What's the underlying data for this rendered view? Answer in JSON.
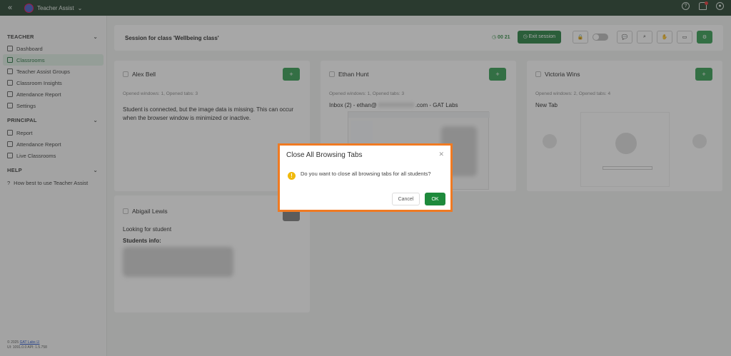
{
  "topbar": {
    "collapse_icon": "«",
    "app_name": "Teacher Assist"
  },
  "sidebar": {
    "teacher_title": "TEACHER",
    "teacher_items": [
      "Dashboard",
      "Classrooms",
      "Teacher Assist Groups",
      "Classroom Insights",
      "Attendance Report",
      "Settings"
    ],
    "principal_title": "PRINCIPAL",
    "principal_items": [
      "Report",
      "Attendance Report",
      "Live Classrooms"
    ],
    "help_title": "HELP",
    "help_items": [
      "How best to use Teacher Assist"
    ],
    "footer_copyright": "© 2025",
    "footer_link": "GAT Labs ☑",
    "footer_version": "UI: 1091.0.0 API: 1.5.758"
  },
  "session": {
    "title": "Session for class 'Wellbeing class'",
    "timer": "00 21",
    "exit_label": "Exit session"
  },
  "cards": {
    "alex": {
      "name": "Alex Bell",
      "meta": "Opened windows: 1, Opened tabs: 3",
      "message": "Student is connected, but the image data is missing. This can occur when the browser window is minimized or inactive."
    },
    "ethan": {
      "name": "Ethan Hunt",
      "meta": "Opened windows: 1, Opened tabs: 3",
      "tab_title": "Inbox (2) - ethan@",
      "tab_title_end": ".com - GAT Labs"
    },
    "victoria": {
      "name": "Victoria Wins",
      "meta": "Opened windows: 2, Opened tabs: 4",
      "tab_title": "New Tab"
    },
    "abigail": {
      "name": "Abigail Lewis",
      "status": "Looking for student",
      "info_label": "Students info:"
    }
  },
  "dialog": {
    "title": "Close All Browsing Tabs",
    "question": "Do you want to close all browsing tabs for all students?",
    "cancel_label": "Cancel",
    "ok_label": "OK"
  }
}
